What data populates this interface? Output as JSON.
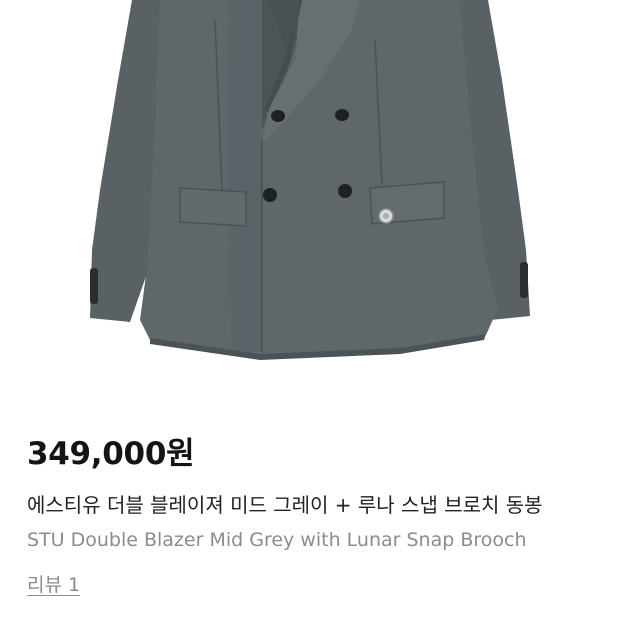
{
  "product": {
    "image_alt": "STU Double Blazer Mid Grey",
    "price": "349,000원",
    "title_ko": "에스티유 더블 블레이져 미드 그레이 + 루나 스냅 브로치 동봉",
    "title_en": "STU Double Blazer Mid Grey with Lunar Snap Brooch",
    "review_link": "리뷰 1"
  },
  "colors": {
    "blazer": "#5c6367",
    "blazer_dark": "#3f4548",
    "button": "#1e2124"
  }
}
